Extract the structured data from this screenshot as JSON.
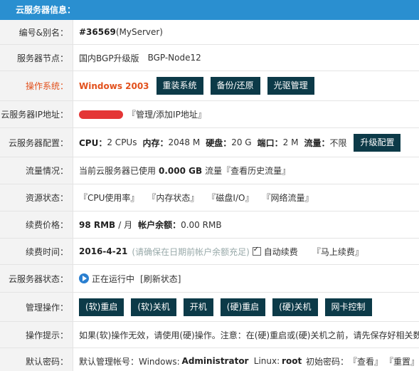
{
  "header": {
    "title": "云服务器信息："
  },
  "rows": {
    "id": {
      "label": "编号&别名：",
      "id": "#36569",
      "alias": "(MyServer)"
    },
    "node": {
      "label": "服务器节点：",
      "line": "国内BGP升级版",
      "node": "BGP-Node12"
    },
    "os": {
      "label": "操作系统：",
      "value": "Windows 2003",
      "buttons": [
        "重装系统",
        "备份/还原",
        "光驱管理"
      ]
    },
    "ip": {
      "label": "云服务器IP地址：",
      "link": "『管理/添加IP地址』"
    },
    "config": {
      "label": "云服务器配置：",
      "cpu_label": "CPU：",
      "cpu": "2 CPUs",
      "mem_label": "内存：",
      "mem": "2048 M",
      "disk_label": "硬盘：",
      "disk": "20 G",
      "port_label": "端口：",
      "port": "2 M",
      "traffic_label": "流量：",
      "traffic": "不限",
      "upgrade_button": "升级配置"
    },
    "traffic": {
      "label": "流量情况：",
      "prefix": "当前云服务器已使用",
      "used": "0.000 GB",
      "unit": "流量",
      "history_link": "『查看历史流量』"
    },
    "resources": {
      "label": "资源状态：",
      "links": [
        "『CPU使用率』",
        "『内存状态』",
        "『磁盘I/O』",
        "『网络流量』"
      ]
    },
    "price": {
      "label": "续费价格：",
      "price": "98 RMB",
      "per": "/ 月",
      "balance_label": "帐户余额：",
      "balance": "0.00 RMB"
    },
    "renew": {
      "label": "续费时间：",
      "date": "2016-4-21",
      "hint": "(请确保在日期前帐户余额充足)",
      "auto_renew": "自动续费",
      "auto_renew_checked": true,
      "renew_link": "『马上续费』"
    },
    "status": {
      "label": "云服务器状态：",
      "running": "正在运行中",
      "refresh_link": "[刷新状态]"
    },
    "manage": {
      "label": "管理操作：",
      "buttons": [
        "(软)重启",
        "(软)关机",
        "开机",
        "(硬)重启",
        "(硬)关机",
        "网卡控制"
      ]
    },
    "tips": {
      "label": "操作提示：",
      "text": "如果(软)操作无效，请使用(硬)操作。注意：在(硬)重启或(硬)关机之前，请先保存好相关数据"
    },
    "password": {
      "label": "默认密码：",
      "account_prefix": "默认管理帐号：Windows:",
      "win_account": "Administrator",
      "linux_prefix": "Linux:",
      "linux_account": "root",
      "pwd_prefix": "初始密码：",
      "view_link": "『查看』",
      "reset_link": "『重置』"
    }
  }
}
